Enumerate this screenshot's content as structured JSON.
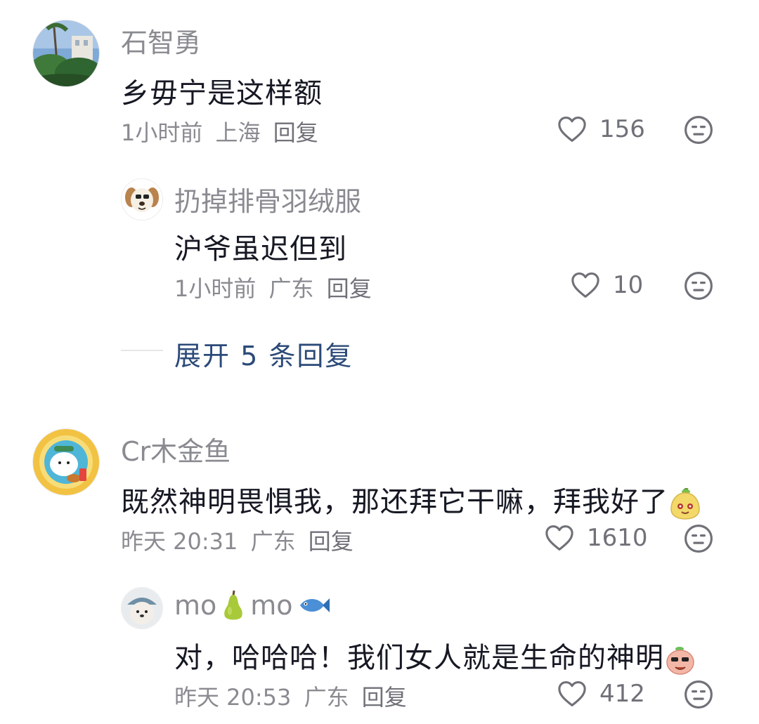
{
  "comments": [
    {
      "username": "石智勇",
      "text": "乡毋宁是这样额",
      "time": "1小时前",
      "location": "上海",
      "reply_label": "回复",
      "likes": "156",
      "replies": [
        {
          "username": "扔掉排骨羽绒服",
          "text": "沪爷虽迟但到",
          "time": "1小时前",
          "location": "广东",
          "reply_label": "回复",
          "likes": "10"
        }
      ],
      "expand_label": "展开 5 条回复"
    },
    {
      "username": "Cr木金鱼",
      "text": "既然神明畏惧我，那还拜它干嘛，拜我好了",
      "time": "昨天 20:31",
      "location": "广东",
      "reply_label": "回复",
      "likes": "1610",
      "replies": [
        {
          "username_part1": "mo",
          "username_part2": "mo",
          "text": "对，哈哈哈！我们女人就是生命的神明",
          "time": "昨天 20:53",
          "location": "广东",
          "reply_label": "回复",
          "likes": "412"
        }
      ]
    }
  ],
  "icons": {
    "like": "heart-outline-icon",
    "dislike": "meh-face-icon"
  },
  "colors": {
    "text": "#161823",
    "muted": "#8a8b91",
    "link": "#2b4a78"
  }
}
